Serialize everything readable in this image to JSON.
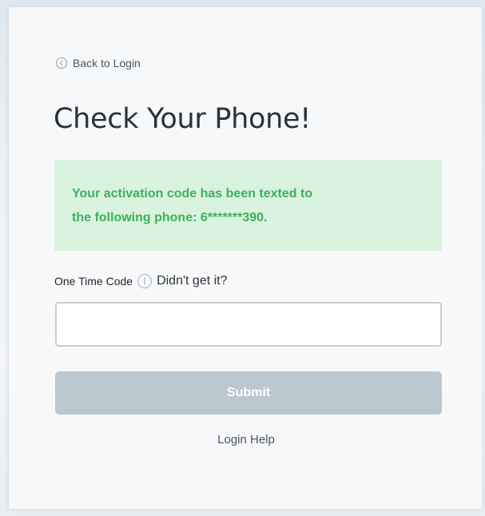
{
  "nav": {
    "back_label": "Back to Login",
    "back_icon": "chevron-left-circle-icon"
  },
  "page": {
    "title": "Check Your Phone!"
  },
  "alert": {
    "line1": "Your activation code has been texted to",
    "line2": "the following phone: 6*******390.",
    "text_color": "#3fb05c",
    "background_color": "#d9f3df"
  },
  "form": {
    "otp_label": "One Time Code",
    "info_icon": "info-circle-icon",
    "resend_label": "Didn't get it?",
    "otp_value": "",
    "otp_placeholder": "",
    "submit_label": "Submit",
    "submit_color": "#bcc8cf"
  },
  "footer": {
    "help_label": "Login Help"
  }
}
